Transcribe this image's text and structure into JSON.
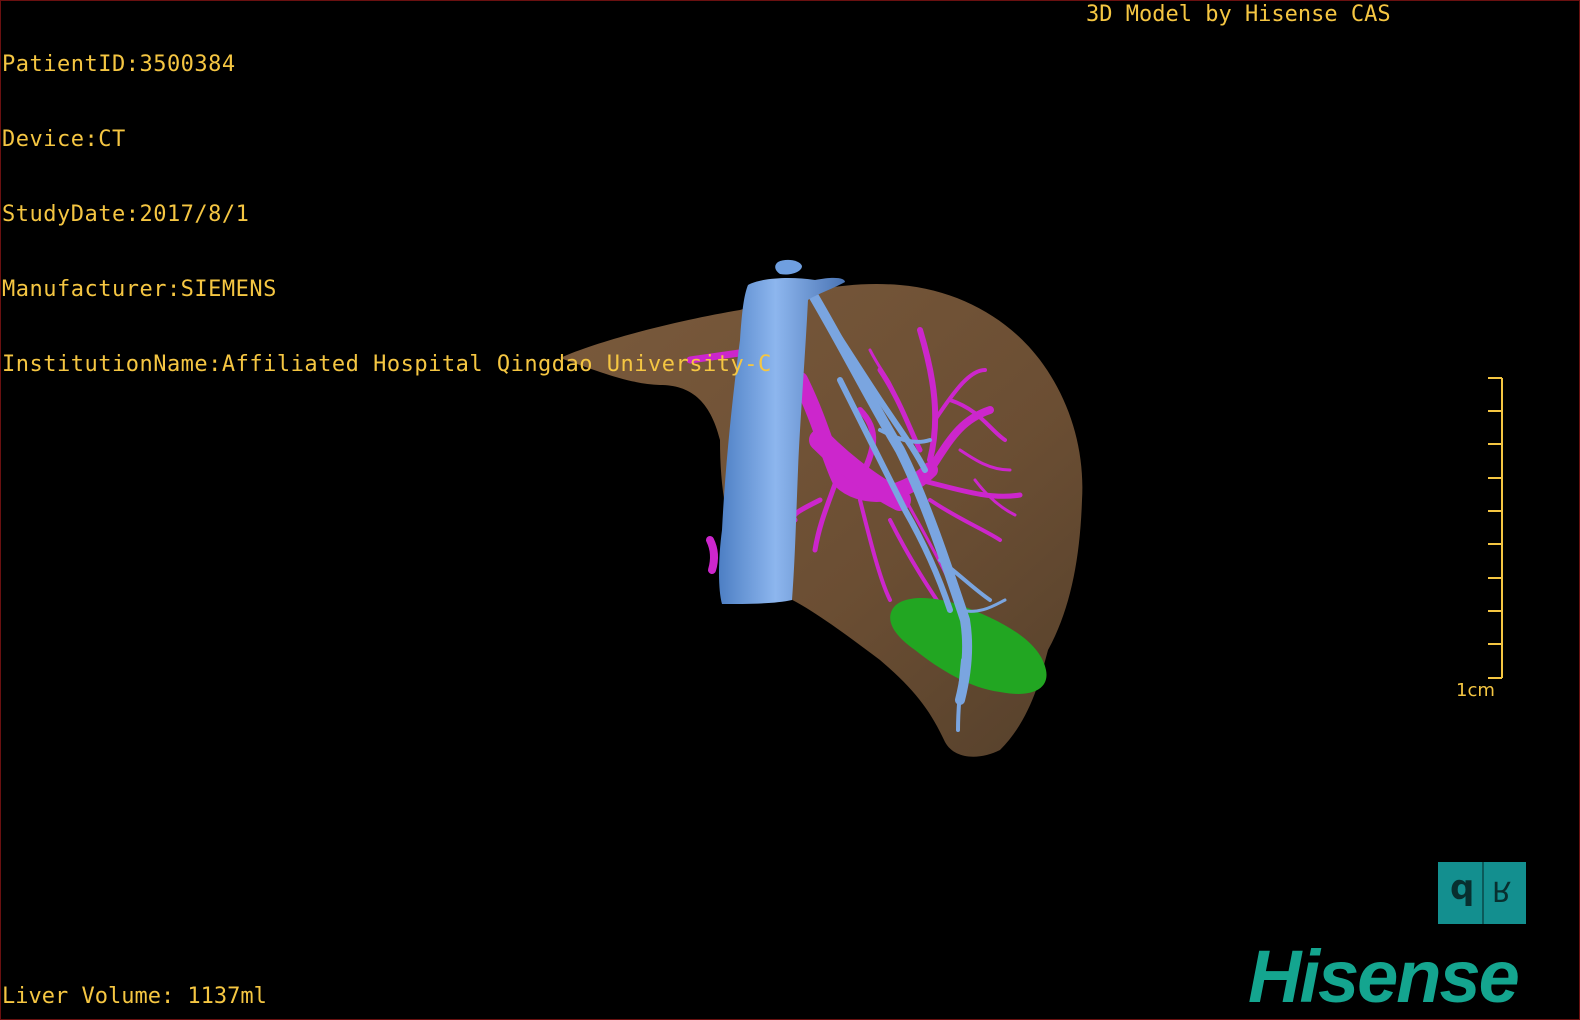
{
  "overlay": {
    "patient_id": "PatientID:3500384",
    "device": "Device:CT",
    "study_date": "StudyDate:2017/8/1",
    "manufacturer": "Manufacturer:SIEMENS",
    "institution": "InstitutionName:Affiliated Hospital Qingdao University-C",
    "credit": "3D Model by Hisense CAS",
    "liver_volume": "Liver Volume: 1137ml"
  },
  "scale_bar": {
    "label": "1cm",
    "ticks": 10
  },
  "orientation_cube": {
    "face_left": "d",
    "face_right": "R"
  },
  "brand": {
    "logo_text": "Hisense"
  },
  "colors": {
    "overlay_text": "#f5c642",
    "liver": "#7d5a3a",
    "vena_cava": "#6f9fe0",
    "portal_vessels": "#cc26cc",
    "gallbladder": "#22a622",
    "brand": "#14a58f"
  }
}
